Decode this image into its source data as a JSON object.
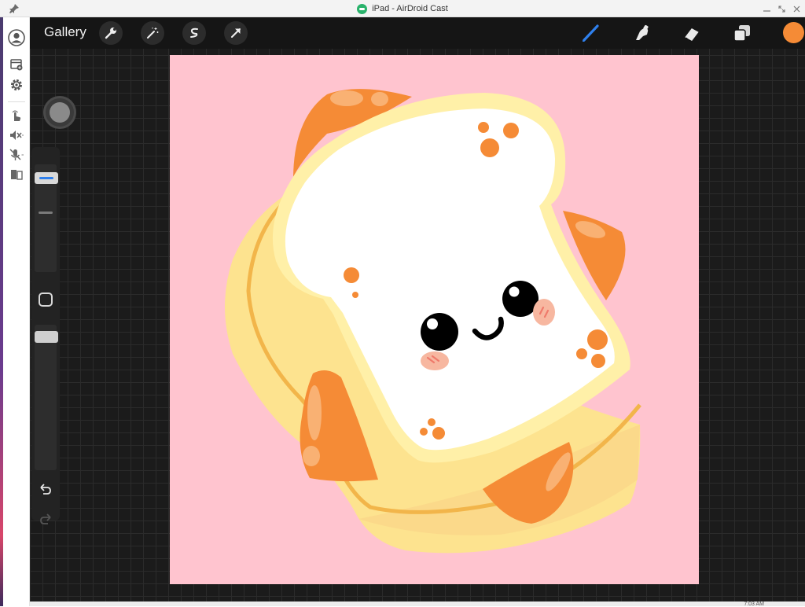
{
  "window": {
    "title": "iPad - AirDroid Cast",
    "controls": [
      "minimize-icon",
      "restore-icon",
      "close-icon"
    ]
  },
  "cast_toolbar": {
    "items": [
      "account-icon",
      "add-device-icon",
      "settings-icon",
      "touch-control-icon",
      "speaker-muted-icon",
      "microphone-muted-icon",
      "split-screen-icon"
    ]
  },
  "procreate": {
    "gallery_label": "Gallery",
    "left_tools": [
      "wrench-icon",
      "magic-wand-icon",
      "selection-icon",
      "transform-arrow-icon"
    ],
    "right_tools": [
      "brush-icon",
      "smudge-icon",
      "eraser-icon",
      "layers-icon"
    ],
    "active_tool": "brush-icon",
    "current_color": "#f58b36",
    "sidebar": [
      "brush-size-slider",
      "modify-button",
      "opacity-slider",
      "undo-icon",
      "redo-icon"
    ]
  },
  "colors": {
    "canvas_background": "#ffc4cf",
    "accent_blue": "#2f80ed",
    "bread_crust": "#fde38f",
    "bread_crumb": "#ffffff",
    "cheese": "#f58b36",
    "cheek": "#f7b7a0"
  },
  "status": {
    "clock": "7:03 AM"
  }
}
